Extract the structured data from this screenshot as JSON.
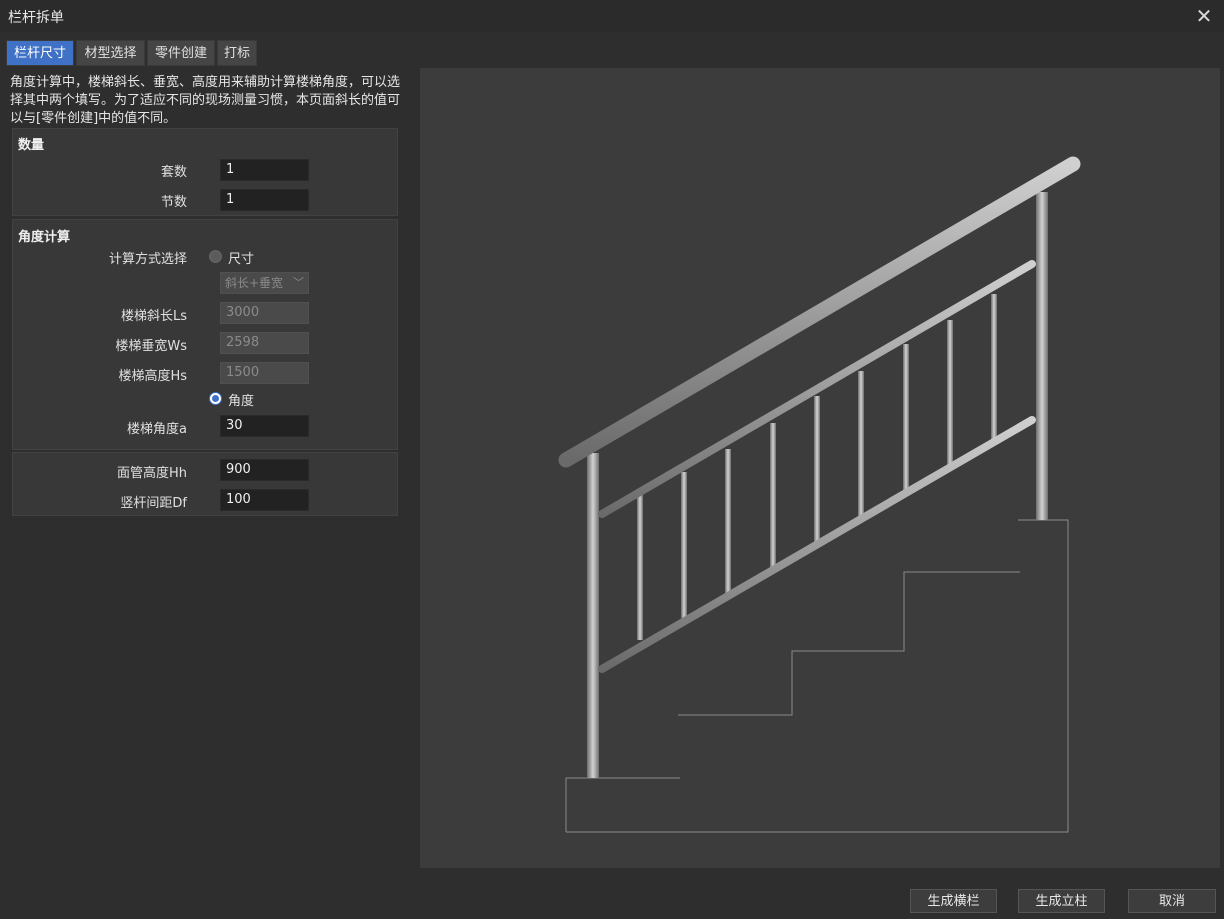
{
  "window": {
    "title": "栏杆拆单",
    "close_icon": "close-icon"
  },
  "tabs": [
    {
      "label": "栏杆尺寸",
      "active": true
    },
    {
      "label": "材型选择",
      "active": false
    },
    {
      "label": "零件创建",
      "active": false
    },
    {
      "label": "打标",
      "active": false
    }
  ],
  "description": "角度计算中，楼梯斜长、垂宽、高度用来辅助计算楼梯角度，可以选择其中两个填写。为了适应不同的现场测量习惯，本页面斜长的值可以与[零件创建]中的值不同。",
  "quantity": {
    "title": "数量",
    "sets_label": "套数",
    "sets_value": "1",
    "sections_label": "节数",
    "sections_value": "1"
  },
  "angle": {
    "title": "角度计算",
    "method_label": "计算方式选择",
    "option_size": "尺寸",
    "combo_value": "斜长+垂宽",
    "slope_label": "楼梯斜长Ls",
    "slope_value": "3000",
    "width_label": "楼梯垂宽Ws",
    "width_value": "2598",
    "height_label": "楼梯高度Hs",
    "height_value": "1500",
    "option_angle": "角度",
    "angle_label": "楼梯角度a",
    "angle_value": "30"
  },
  "rail": {
    "face_height_label": "面管高度Hh",
    "face_height_value": "900",
    "spacing_label": "竖杆间距Df",
    "spacing_value": "100"
  },
  "buttons": {
    "gen_rail": "生成横栏",
    "gen_post": "生成立柱",
    "cancel": "取消"
  }
}
